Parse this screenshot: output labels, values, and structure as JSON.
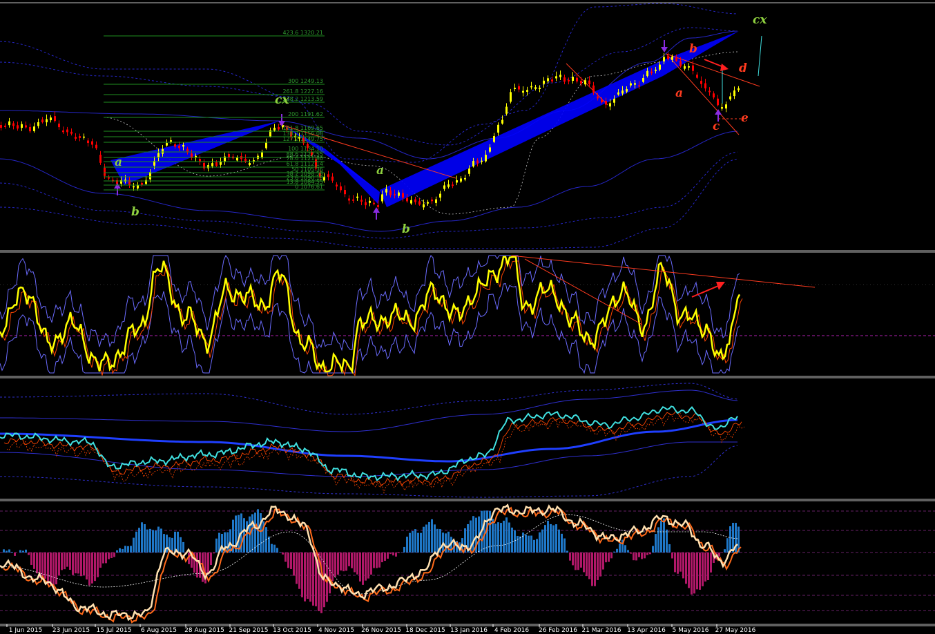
{
  "chart_data": [
    {
      "type": "candlestick",
      "panel": "price",
      "fib_levels": [
        {
          "ratio": "423.6",
          "price": "1320.21"
        },
        {
          "ratio": "300",
          "price": "1249.13"
        },
        {
          "ratio": "261.8",
          "price": "1227.16"
        },
        {
          "ratio": "238.2",
          "price": "1213.59"
        },
        {
          "ratio": "200",
          "price": "1191.62"
        },
        {
          "ratio": "161.8",
          "price": "1169.65"
        },
        {
          "ratio": "138.2",
          "price": "1156.08"
        },
        {
          "ratio": "127.2",
          "price": "1149.75"
        },
        {
          "ratio": "100",
          "price": "1134.10"
        },
        {
          "ratio": "88.6",
          "price": "1127.55"
        },
        {
          "ratio": "78.6",
          "price": "1121.80"
        },
        {
          "ratio": "61.8",
          "price": "1112.14"
        },
        {
          "ratio": "50",
          "price": "1105.36"
        },
        {
          "ratio": "38.2",
          "price": "1098.58"
        },
        {
          "ratio": "23.6",
          "price": "1090.19"
        },
        {
          "ratio": "13.8",
          "price": "1084.55"
        },
        {
          "ratio": "0",
          "price": "1076.61"
        }
      ],
      "wave_labels": [
        {
          "text": "a",
          "color": "#8fd13f"
        },
        {
          "text": "b",
          "color": "#8fd13f"
        },
        {
          "text": "cx",
          "color": "#8fd13f"
        },
        {
          "text": "a",
          "color": "#8fd13f"
        },
        {
          "text": "b",
          "color": "#8fd13f"
        },
        {
          "text": "cx",
          "color": "#8fd13f"
        },
        {
          "text": "b",
          "color": "#ff3b1f"
        },
        {
          "text": "d",
          "color": "#ff3b1f"
        },
        {
          "text": "a",
          "color": "#ff3b1f"
        },
        {
          "text": "c",
          "color": "#ff3b1f"
        },
        {
          "text": "e",
          "color": "#ff3b1f"
        }
      ],
      "colors": {
        "bull_candle": "#ffff00",
        "bear_candle": "#ff0000",
        "pattern_fill": "#0000ff",
        "fib_line": "#1f8f1f",
        "band": "#2626c8"
      }
    },
    {
      "type": "line",
      "panel": "oscillator",
      "colors": {
        "main": "#ffff00",
        "signal": "#ff4500",
        "bands": "#6b6bff",
        "level": "#b020b0"
      }
    },
    {
      "type": "line",
      "panel": "trend",
      "colors": {
        "main": "#40e0e0",
        "ma": "#1f3fff",
        "signal": "#ff4500",
        "bands": "#2f2fd0"
      }
    },
    {
      "type": "bar",
      "panel": "histogram",
      "colors": {
        "positive": "#1f78c8",
        "negative": "#b01868",
        "fast": "#ff6a1a",
        "slow": "#ffe0b0",
        "signal": "#ffffff"
      }
    }
  ],
  "x_axis": {
    "dates": [
      "1 Jun 2015",
      "23 Jun 2015",
      "15 Jul 2015",
      "6 Aug 2015",
      "28 Aug 2015",
      "21 Sep 2015",
      "13 Oct 2015",
      "4 Nov 2015",
      "26 Nov 2015",
      "18 Dec 2015",
      "13 Jan 2016",
      "4 Feb 2016",
      "26 Feb 2016",
      "21 Mar 2016",
      "13 Apr 2016",
      "5 May 2016",
      "27 May 2016"
    ]
  }
}
